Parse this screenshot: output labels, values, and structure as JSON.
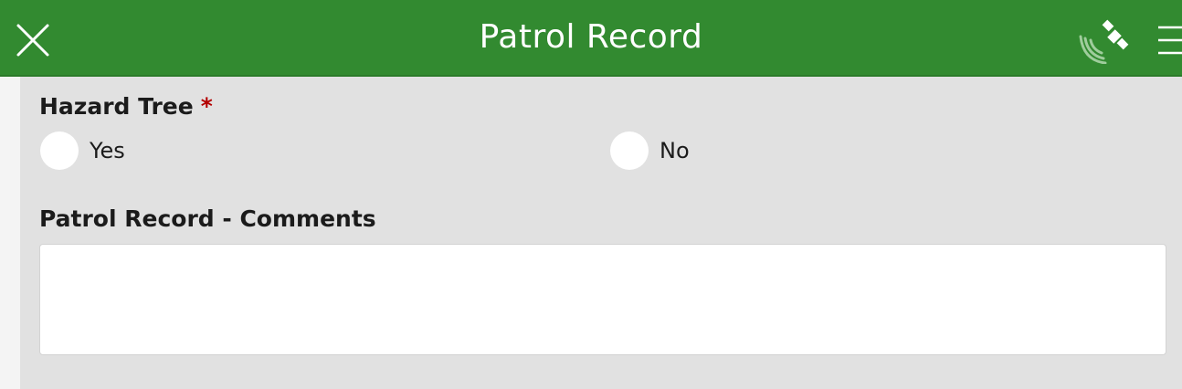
{
  "header": {
    "title": "Patrol Record",
    "close_icon": "close-icon",
    "gps_icon": "satellite-gps-icon",
    "menu_icon": "menu-icon"
  },
  "form": {
    "hazard_tree": {
      "label": "Hazard Tree",
      "required_marker": "*",
      "options": [
        {
          "label": "Yes",
          "selected": false
        },
        {
          "label": "No",
          "selected": false
        }
      ]
    },
    "comments": {
      "label": "Patrol Record - Comments",
      "value": ""
    }
  },
  "colors": {
    "header_bg": "#328a30",
    "form_bg": "#e1e1e1",
    "required": "#b30000"
  }
}
